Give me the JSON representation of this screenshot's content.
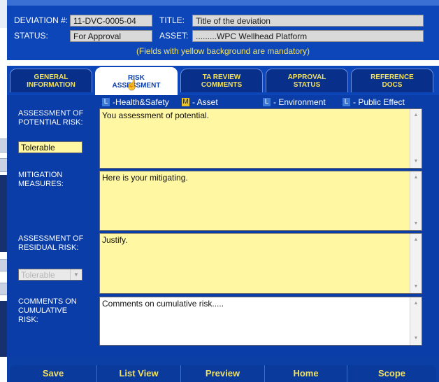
{
  "header": {
    "deviation_label": "DEVIATION #:",
    "deviation_value": "11-DVC-0005-04",
    "title_label": "TITLE:",
    "title_value": "Title of the deviation",
    "status_label": "STATUS:",
    "status_value": "For Approval",
    "asset_label": "ASSET:",
    "asset_value": ".........WPC Wellhead Platform",
    "hint": "(Fields with yellow background are mandatory)"
  },
  "tabs": [
    {
      "line1": "GENERAL",
      "line2": "INFORMATION"
    },
    {
      "line1": "RISK",
      "line2": "ASSESSMENT"
    },
    {
      "line1": "TA REVIEW",
      "line2": "COMMENTS"
    },
    {
      "line1": "APPROVAL",
      "line2": "STATUS"
    },
    {
      "line1": "REFERENCE",
      "line2": "DOCS"
    }
  ],
  "legend": [
    {
      "badge": "L",
      "label": "-Health&Safety"
    },
    {
      "badge": "M",
      "label": "- Asset"
    },
    {
      "badge": "L",
      "label": "- Environment"
    },
    {
      "badge": "L",
      "label": "- Public Effect"
    }
  ],
  "fields": {
    "potential_risk_label": "ASSESSMENT OF POTENTIAL RISK:",
    "potential_risk_value": "Tolerable",
    "potential_risk_text": "You assessment of potential.",
    "mitigation_label": "MITIGATION MEASURES:",
    "mitigation_text": "Here is your mitigating.",
    "residual_risk_label": "ASSESSMENT OF RESIDUAL RISK:",
    "residual_risk_value": "Tolerable",
    "residual_risk_text": "Justify.",
    "cumulative_label": "COMMENTS ON CUMULATIVE RISK:",
    "cumulative_text": "Comments on cumulative risk....."
  },
  "buttons": {
    "save": "Save",
    "list_view": "List View",
    "preview": "Preview",
    "home": "Home",
    "scope": "Scope"
  }
}
